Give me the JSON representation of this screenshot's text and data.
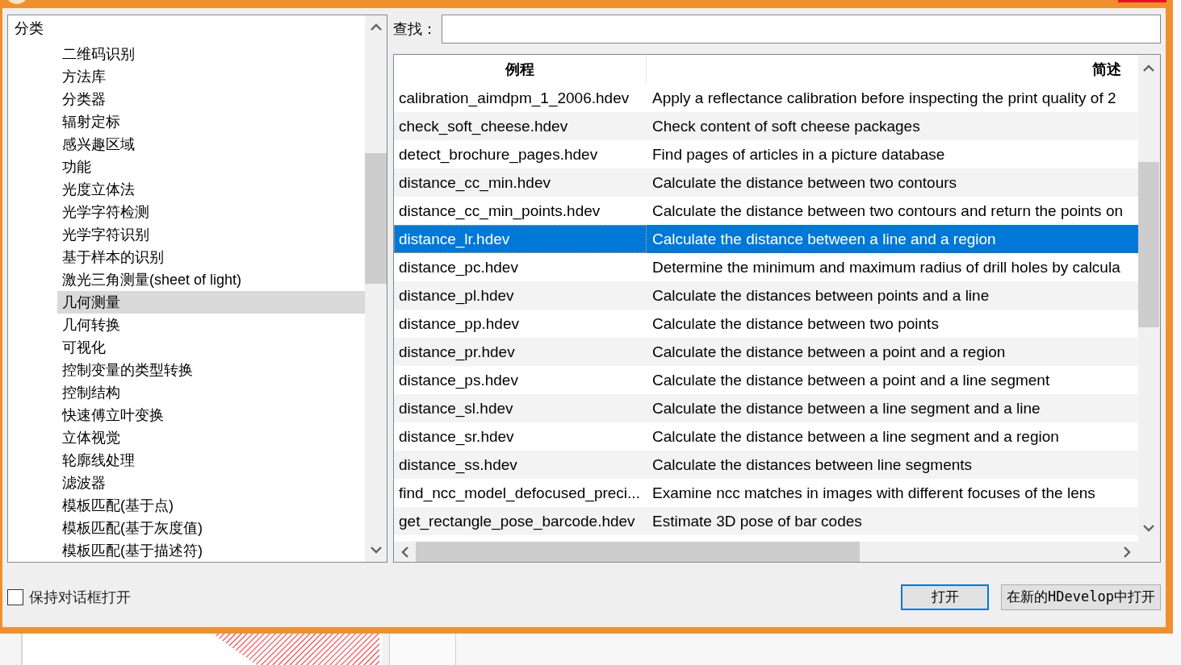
{
  "tree": {
    "label": "分类",
    "selected": false,
    "children": [
      {
        "label": "二维码识别",
        "selected": false
      },
      {
        "label": "方法库",
        "selected": false
      },
      {
        "label": "分类器",
        "selected": false
      },
      {
        "label": "辐射定标",
        "selected": false
      },
      {
        "label": "感兴趣区域",
        "selected": false
      },
      {
        "label": "功能",
        "selected": false
      },
      {
        "label": "光度立体法",
        "selected": false
      },
      {
        "label": "光学字符检测",
        "selected": false
      },
      {
        "label": "光学字符识别",
        "selected": false
      },
      {
        "label": "基于样本的识别",
        "selected": false
      },
      {
        "label": "激光三角测量(sheet of light)",
        "selected": false
      },
      {
        "label": "几何测量",
        "selected": true
      },
      {
        "label": "几何转换",
        "selected": false
      },
      {
        "label": "可视化",
        "selected": false
      },
      {
        "label": "控制变量的类型转换",
        "selected": false
      },
      {
        "label": "控制结构",
        "selected": false
      },
      {
        "label": "快速傅立叶变换",
        "selected": false
      },
      {
        "label": "立体视觉",
        "selected": false
      },
      {
        "label": "轮廓线处理",
        "selected": false
      },
      {
        "label": "滤波器",
        "selected": false
      },
      {
        "label": "模板匹配(基于点)",
        "selected": false
      },
      {
        "label": "模板匹配(基于灰度值)",
        "selected": false
      },
      {
        "label": "模板匹配(基于描述符)",
        "selected": false
      }
    ]
  },
  "search": {
    "label": "查找："
  },
  "table": {
    "columns": [
      "例程",
      "简述"
    ],
    "rows": [
      {
        "name": "calibration_aimdpm_1_2006.hdev",
        "description": "Apply a reflectance calibration before inspecting the print quality of 2",
        "selected": false
      },
      {
        "name": "check_soft_cheese.hdev",
        "description": "Check content of soft cheese packages",
        "selected": false
      },
      {
        "name": "detect_brochure_pages.hdev",
        "description": "Find pages of articles in a picture database",
        "selected": false
      },
      {
        "name": "distance_cc_min.hdev",
        "description": "Calculate the distance between two contours",
        "selected": false
      },
      {
        "name": "distance_cc_min_points.hdev",
        "description": "Calculate the distance between two contours and return the points on",
        "selected": false
      },
      {
        "name": "distance_lr.hdev",
        "description": "Calculate the distance between a line and a region",
        "selected": true
      },
      {
        "name": "distance_pc.hdev",
        "description": "Determine the minimum and maximum radius of drill holes by calcula",
        "selected": false
      },
      {
        "name": "distance_pl.hdev",
        "description": "Calculate the distances between points and a line",
        "selected": false
      },
      {
        "name": "distance_pp.hdev",
        "description": "Calculate the distance between two points",
        "selected": false
      },
      {
        "name": "distance_pr.hdev",
        "description": "Calculate the distance between a point and a region",
        "selected": false
      },
      {
        "name": "distance_ps.hdev",
        "description": "Calculate the distance between a point and a line segment",
        "selected": false
      },
      {
        "name": "distance_sl.hdev",
        "description": "Calculate the distance between a line segment and a line",
        "selected": false
      },
      {
        "name": "distance_sr.hdev",
        "description": "Calculate the distance between a line segment and a region",
        "selected": false
      },
      {
        "name": "distance_ss.hdev",
        "description": "Calculate the distances between line segments",
        "selected": false
      },
      {
        "name": "find_ncc_model_defocused_preci...",
        "description": "Examine ncc matches in images with different focuses of the lens",
        "selected": false
      },
      {
        "name": "get_rectangle_pose_barcode.hdev",
        "description": "Estimate 3D pose of bar codes",
        "selected": false
      }
    ]
  },
  "keep_open": {
    "label": "保持对话框打开",
    "checked": false
  },
  "buttons": [
    {
      "label": "打开",
      "default": true
    },
    {
      "label": "在新的HDevelop中打开",
      "default": false
    }
  ]
}
